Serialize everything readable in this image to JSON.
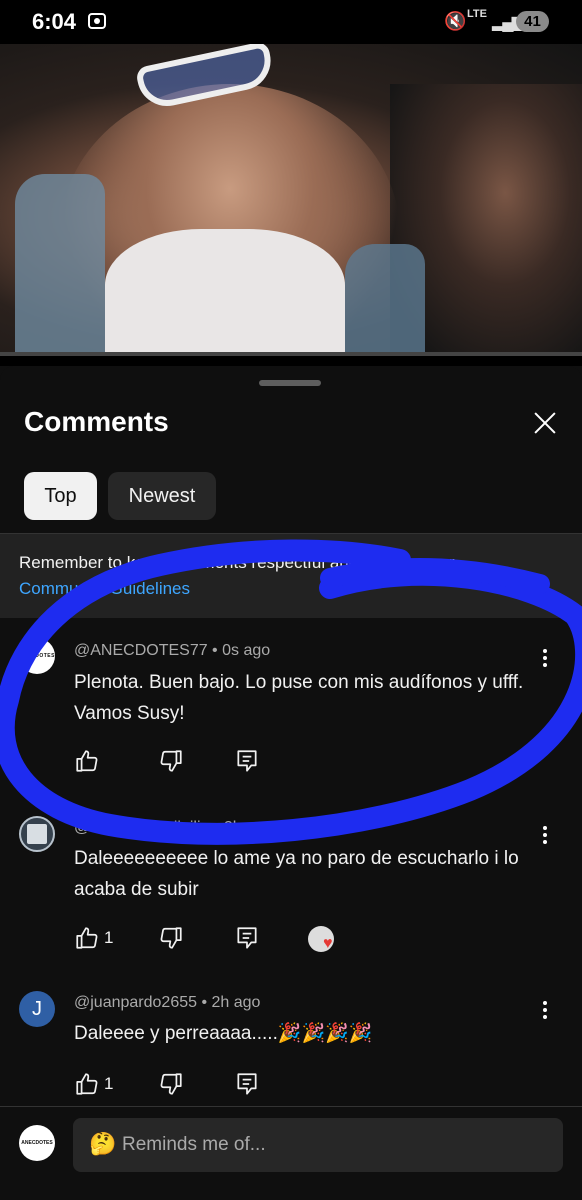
{
  "status_bar": {
    "time": "6:04",
    "network": "LTE",
    "battery": "41"
  },
  "sheet": {
    "title": "Comments",
    "filters": [
      "Top",
      "Newest"
    ],
    "notice": {
      "text": "Remember to keep comments respectful and to follow our",
      "link": "Community Guidelines"
    }
  },
  "comments": [
    {
      "avatar_text": "ANECDOTES",
      "author": "@ANECDOTES77",
      "time": "0s ago",
      "text": "Plenota. Buen bajo. Lo puse con mis audífonos y ufff. Vamos Susy!",
      "likes": ""
    },
    {
      "author": "@RuthMartindigilio",
      "time": "2h ago",
      "text": "Daleeeeeeeeee lo ame ya no paro de escucharlo i lo acaba de subir",
      "likes": "1"
    },
    {
      "avatar_text": "J",
      "author": "@juanpardo2655",
      "time": "2h ago",
      "text": "Daleeee y perreaaaa.....🎉🎉🎉🎉",
      "likes": "1"
    }
  ],
  "composer": {
    "avatar_text": "ANECDOTES",
    "emoji": "🤔",
    "placeholder": "Reminds me of..."
  },
  "colors": {
    "annotation_stroke": "#1e2cf0",
    "link": "#3ea6ff"
  },
  "icons": [
    "mute-icon",
    "signal-icon",
    "close-icon",
    "like-icon",
    "dislike-icon",
    "reply-icon",
    "more-icon",
    "heart-icon"
  ]
}
